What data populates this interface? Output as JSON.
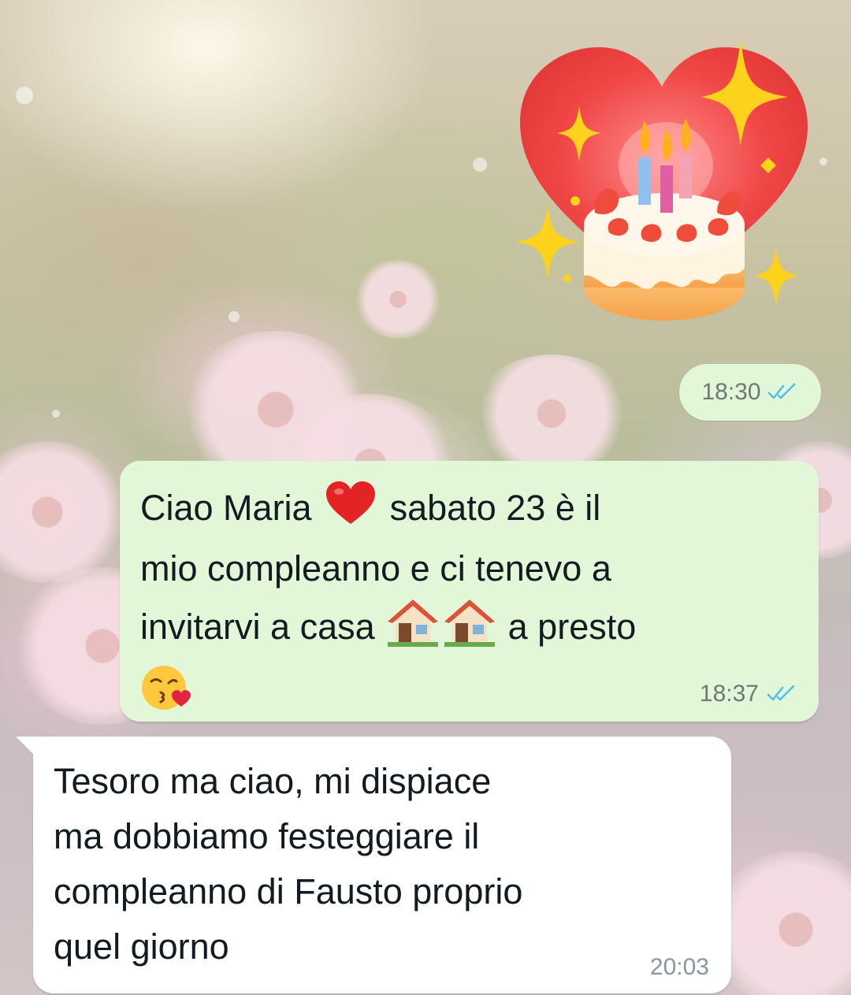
{
  "chat": {
    "messages": [
      {
        "direction": "outgoing",
        "type": "sticker",
        "sticker": "birthday-cake-heart-sticker",
        "time": "18:30",
        "status": "read"
      },
      {
        "direction": "outgoing",
        "type": "text",
        "lines": [
          {
            "before": "Ciao Maria",
            "emoji": "red-heart",
            "after": "sabato 23 è il"
          },
          {
            "text": "mio compleanno e ci tenevo a"
          },
          {
            "before": "invitarvi a casa",
            "emoji": "house-house",
            "after": "a presto"
          },
          {
            "emoji": "face-blowing-kiss"
          }
        ],
        "time": "18:37",
        "status": "read"
      },
      {
        "direction": "incoming",
        "type": "text",
        "lines": [
          {
            "text": "Tesoro ma ciao, mi dispiace"
          },
          {
            "text": "ma dobbiamo festeggiare il"
          },
          {
            "text": "compleanno di Fausto proprio"
          },
          {
            "text": "quel giorno"
          }
        ],
        "time": "20:03"
      }
    ],
    "colors": {
      "outgoing_bubble": "#e1f7d8",
      "incoming_bubble": "#ffffff",
      "read_ticks": "#53bdeb",
      "timestamp": "#6d7a72"
    }
  }
}
